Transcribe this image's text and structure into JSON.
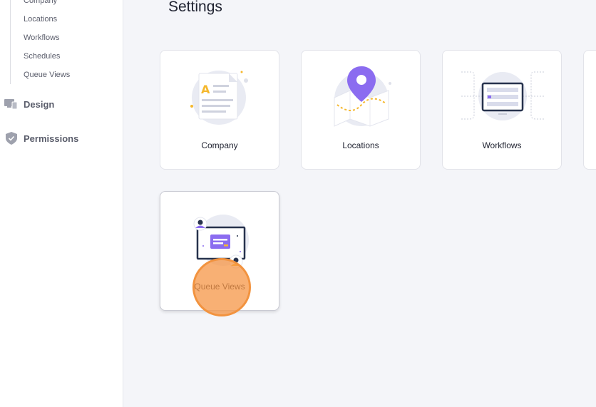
{
  "sidebar": {
    "sub_items": [
      {
        "label": "Company"
      },
      {
        "label": "Locations"
      },
      {
        "label": "Workflows"
      },
      {
        "label": "Schedules"
      },
      {
        "label": "Queue Views"
      }
    ],
    "groups": [
      {
        "label": "Design",
        "icon": "monitor-icon"
      },
      {
        "label": "Permissions",
        "icon": "shield-icon"
      }
    ]
  },
  "main": {
    "title": "Settings",
    "cards": [
      {
        "label": "Company",
        "icon": "document-icon"
      },
      {
        "label": "Locations",
        "icon": "map-pin-icon"
      },
      {
        "label": "Workflows",
        "icon": "workflow-screen-icon"
      },
      {
        "label": "Queue Views",
        "icon": "queue-monitor-icon"
      }
    ]
  },
  "colors": {
    "accent_purple": "#8b6cf0",
    "accent_yellow": "#f5b82e",
    "navy": "#27324d",
    "cursor_orange": "#f2933f"
  }
}
